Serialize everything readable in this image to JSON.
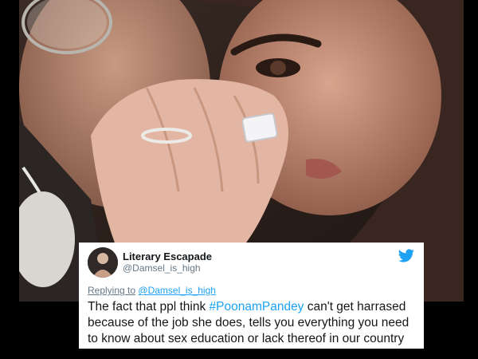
{
  "tweet": {
    "display_name": "Literary Escapade",
    "handle": "@Damsel_is_high",
    "reply_prefix": "Replying to",
    "reply_target": "@Damsel_is_high",
    "text_before": "The fact that ppl think ",
    "hashtag": "#PoonamPandey",
    "text_after": " can't get harrased because of the job she does, tells you everything you need to know about sex education or lack thereof in our country",
    "twitter_icon": "twitter-bird-icon",
    "link_color": "#1da1f2"
  },
  "photo": {
    "subject": "couple-selfie-ring-photo"
  }
}
